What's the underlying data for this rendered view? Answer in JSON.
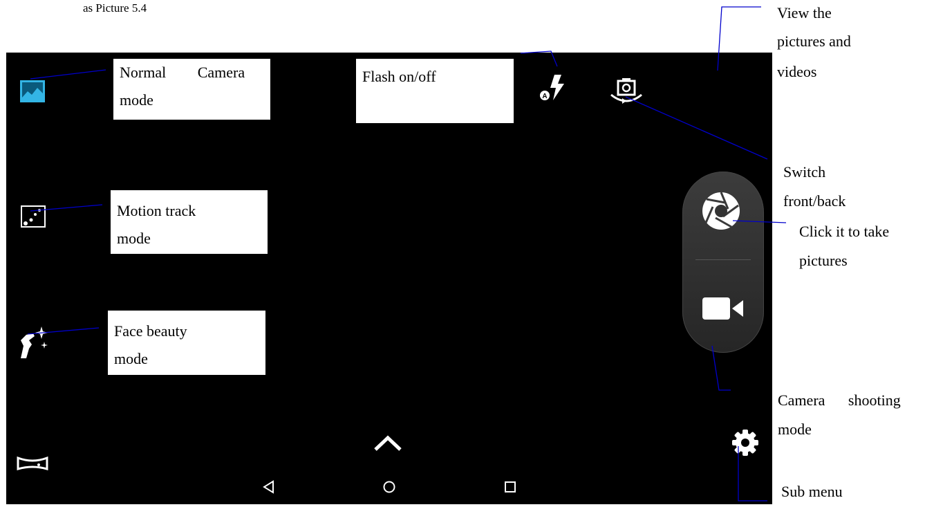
{
  "caption": "as Picture 5.4",
  "callouts": {
    "normal_camera_line1": "Normal Camera",
    "normal_camera_line2": "mode",
    "flash": "Flash on/off",
    "motion_track_line1": "Motion track",
    "motion_track_line2": "mode",
    "face_beauty_line1": "Face beauty",
    "face_beauty_line2": "mode",
    "view_line1": "View the",
    "view_line2": "pictures and",
    "view_line3": "videos",
    "switch_line1": "Switch",
    "switch_line2": "front/back",
    "take_line1": "Click it to take",
    "take_line2": "pictures",
    "shooting_line1": "Camera shooting",
    "shooting_line2": "mode",
    "submenu": "Sub menu"
  },
  "icons": {
    "normal_mode": "landscape-icon",
    "motion_track": "motion-dots-icon",
    "face_beauty": "face-sparkle-icon",
    "panorama": "panorama-icon",
    "flash": "flash-auto-icon",
    "switch_camera": "camera-switch-icon",
    "shutter": "aperture-icon",
    "video": "video-camera-icon",
    "settings": "gear-icon",
    "expand": "chevron-up-icon",
    "nav_back": "back-triangle-icon",
    "nav_home": "home-circle-icon",
    "nav_recent": "recent-square-icon"
  },
  "colors": {
    "screen_bg": "#000000",
    "accent": "#33b5e5",
    "callout_line": "#0000cc"
  }
}
